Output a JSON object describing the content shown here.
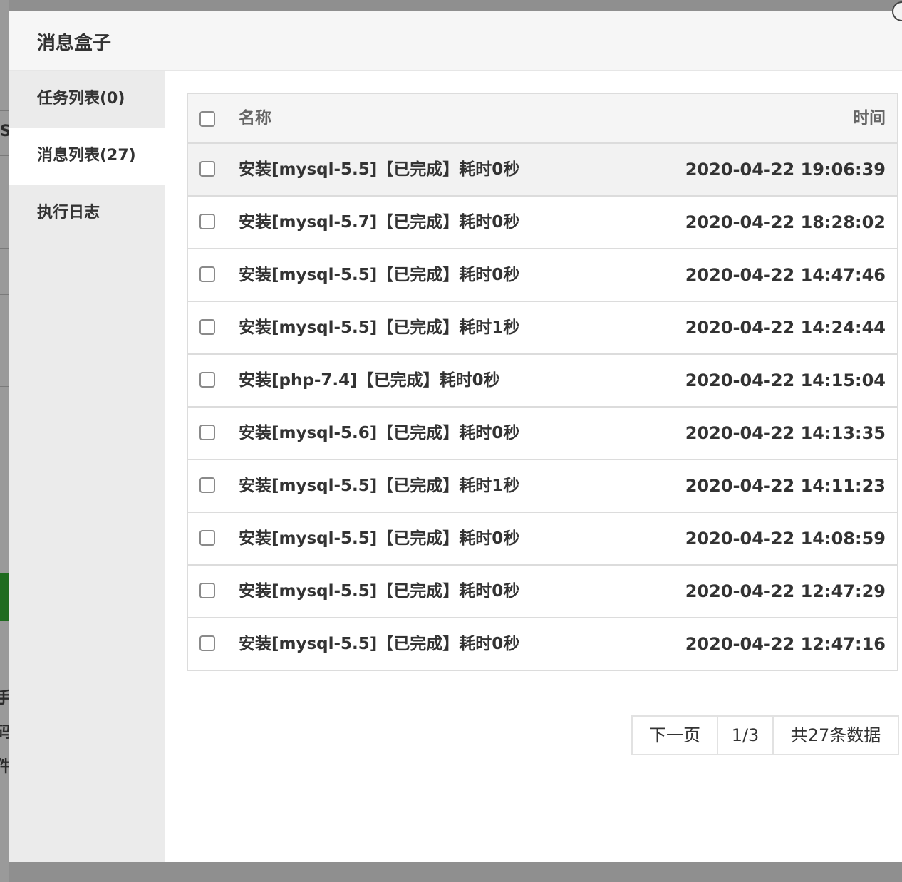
{
  "modal": {
    "title": "消息盒子"
  },
  "sidebar": {
    "items": [
      {
        "label": "任务列表(0)",
        "active": false
      },
      {
        "label": "消息列表(27)",
        "active": true
      },
      {
        "label": "执行日志",
        "active": false
      }
    ]
  },
  "table": {
    "headers": {
      "name": "名称",
      "time": "时间"
    },
    "rows": [
      {
        "name": "安装[mysql-5.5]【已完成】耗时0秒",
        "time": "2020-04-22 19:06:39"
      },
      {
        "name": "安装[mysql-5.7]【已完成】耗时0秒",
        "time": "2020-04-22 18:28:02"
      },
      {
        "name": "安装[mysql-5.5]【已完成】耗时0秒",
        "time": "2020-04-22 14:47:46"
      },
      {
        "name": "安装[mysql-5.5]【已完成】耗时1秒",
        "time": "2020-04-22 14:24:44"
      },
      {
        "name": "安装[php-7.4]【已完成】耗时0秒",
        "time": "2020-04-22 14:15:04"
      },
      {
        "name": "安装[mysql-5.6]【已完成】耗时0秒",
        "time": "2020-04-22 14:13:35"
      },
      {
        "name": "安装[mysql-5.5]【已完成】耗时1秒",
        "time": "2020-04-22 14:11:23"
      },
      {
        "name": "安装[mysql-5.5]【已完成】耗时0秒",
        "time": "2020-04-22 14:08:59"
      },
      {
        "name": "安装[mysql-5.5]【已完成】耗时0秒",
        "time": "2020-04-22 12:47:29"
      },
      {
        "name": "安装[mysql-5.5]【已完成】耗时0秒",
        "time": "2020-04-22 12:47:16"
      }
    ]
  },
  "pager": {
    "next_label": "下一页",
    "page": "1/3",
    "total": "共27条数据"
  },
  "background": {
    "chars": [
      "S",
      "手",
      "码",
      "件"
    ]
  },
  "colors": {
    "overlay": "#8f8f8f",
    "sidebar": "#ebebeb",
    "accent_green": "#1f6b1f"
  }
}
